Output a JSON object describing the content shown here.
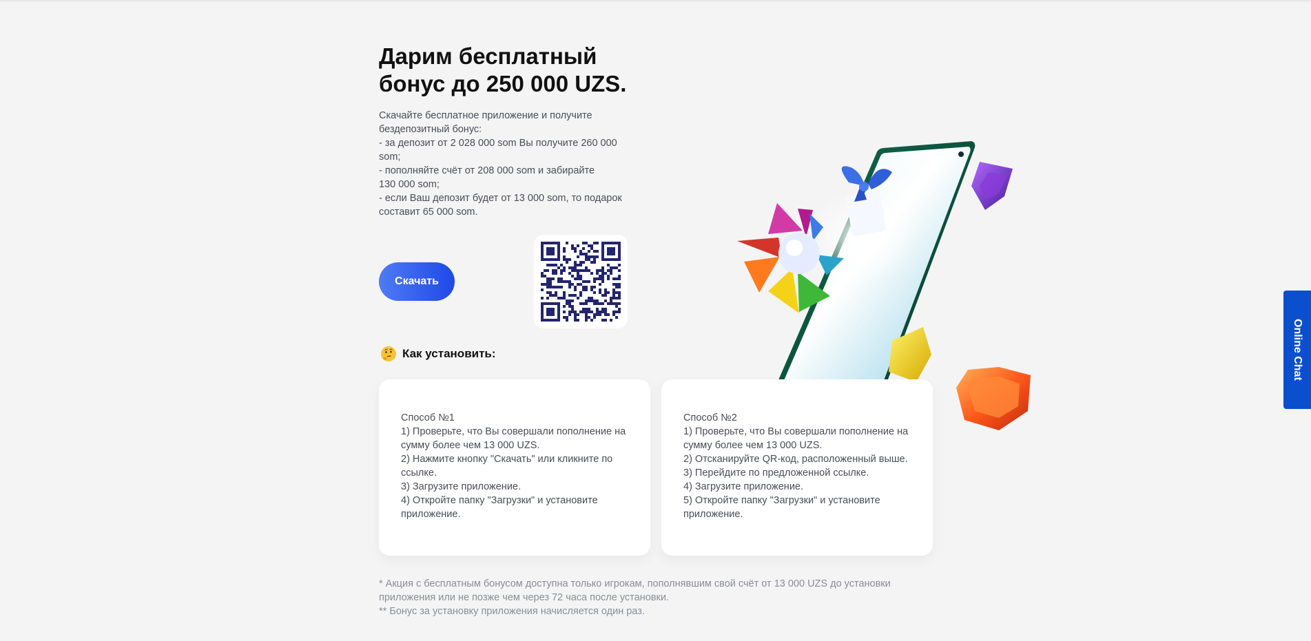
{
  "hero": {
    "title_line1": "Дарим бесплатный",
    "title_line2": "бонус до 250 000 UZS.",
    "description": [
      "Скачайте бесплатное приложение и получите",
      "бездепозитный бонус:",
      "- за депозит от 2 028 000 som Вы получите 260 000 som;",
      "- пополняйте счёт от 208 000 som и забирайте",
      "130 000 som;",
      "- если Ваш депозит будет от 13 000 som, то подарок",
      "составит 65 000 som."
    ],
    "download_label": "Скачать"
  },
  "how_to": {
    "emoji_icon": "thinking-face-icon",
    "label": "Как установить:"
  },
  "methods": [
    {
      "title": "Способ №1",
      "lines": [
        "1) Проверьте, что Вы совершали пополнение на",
        "сумму более чем 13 000 UZS.",
        "2) Нажмите кнопку \"Скачать\" или кликните по",
        "ссылке.",
        "3) Загрузите приложение.",
        "4) Откройте папку \"Загрузки\" и установите",
        "приложение."
      ]
    },
    {
      "title": "Способ №2",
      "lines": [
        "1) Проверьте, что Вы совершали пополнение на",
        "сумму более чем 13 000 UZS.",
        "2) Отсканируйте QR-код, расположенный выше.",
        "3) Перейдите по предложенной ссылке.",
        "4) Загрузите приложение.",
        "5) Откройте папку \"Загрузки\" и установите",
        "приложение."
      ]
    }
  ],
  "footnotes": [
    "* Акция с бесплатным бонусом доступна только игрокам, пополнявшим свой счёт от 13 000 UZS до установки",
    "приложения или не позже чем через 72 часа после установки.",
    "** Бонус за установку приложения начисляется один раз."
  ],
  "online_chat": {
    "label": "Online Chat"
  },
  "colors": {
    "accent": "#1f48e8",
    "chat_tab": "#0b4fcf",
    "background": "#f4f4f5",
    "qr_dark": "#23256e"
  }
}
